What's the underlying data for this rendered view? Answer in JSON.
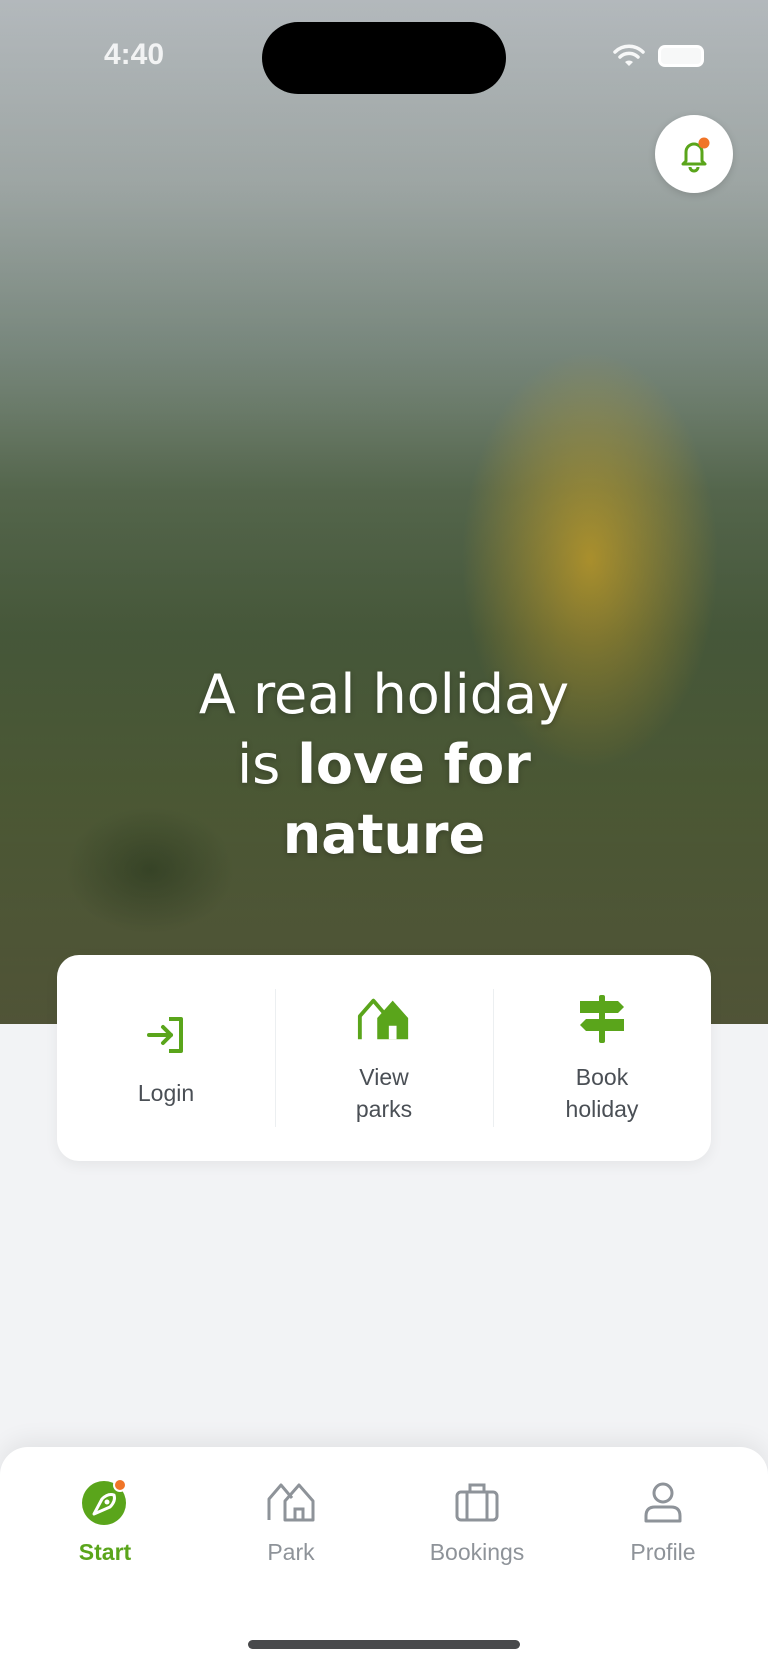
{
  "status_bar": {
    "time": "4:40"
  },
  "hero": {
    "tagline_line1": "A real holiday",
    "tagline_line2_regular": "is ",
    "tagline_line2_bold": "love for",
    "tagline_line3_bold": "nature"
  },
  "actions": [
    {
      "label": "Login",
      "icon": "login-icon"
    },
    {
      "label": "View parks",
      "icon": "house-icon"
    },
    {
      "label": "Book holiday",
      "icon": "signpost-icon"
    }
  ],
  "nav": [
    {
      "label": "Start",
      "icon": "start-logo-icon",
      "active": true
    },
    {
      "label": "Park",
      "icon": "park-house-icon",
      "active": false
    },
    {
      "label": "Bookings",
      "icon": "suitcase-icon",
      "active": false
    },
    {
      "label": "Profile",
      "icon": "person-icon",
      "active": false
    }
  ],
  "colors": {
    "accent": "#5aa51b",
    "notification_dot": "#f07427",
    "background": "#f2f3f5"
  }
}
